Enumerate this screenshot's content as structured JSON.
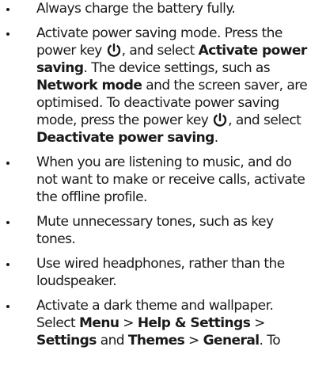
{
  "tips": [
    {
      "text": "Always charge the battery fully."
    },
    {
      "part1": "Activate power saving mode. Press the power key ",
      "part2": ", and select ",
      "bold1": "Activate power saving",
      "part3": ". The device settings, such as ",
      "bold2": "Network mode",
      "part4": " and the screen saver, are optimised. To deactivate power saving mode, press the power key ",
      "part5": ", and select ",
      "bold3": "Deactivate power saving",
      "part6": "."
    },
    {
      "text": "When you are listening to music, and do not want to make or receive calls, activate the offline profile."
    },
    {
      "text": "Mute unnecessary tones, such as key tones."
    },
    {
      "text": "Use wired headphones, rather than the loudspeaker."
    },
    {
      "part1": "Activate a dark theme and wallpaper. Select ",
      "bold1": "Menu",
      "part2": "  > ",
      "bold2": "Help & Settings",
      "part3": "  > ",
      "bold3": "Settings",
      "part4": " and ",
      "bold4": "Themes",
      "part5": "  > ",
      "bold5": "General",
      "part6": ". To"
    }
  ],
  "icons": {
    "power": "power-key-icon"
  }
}
